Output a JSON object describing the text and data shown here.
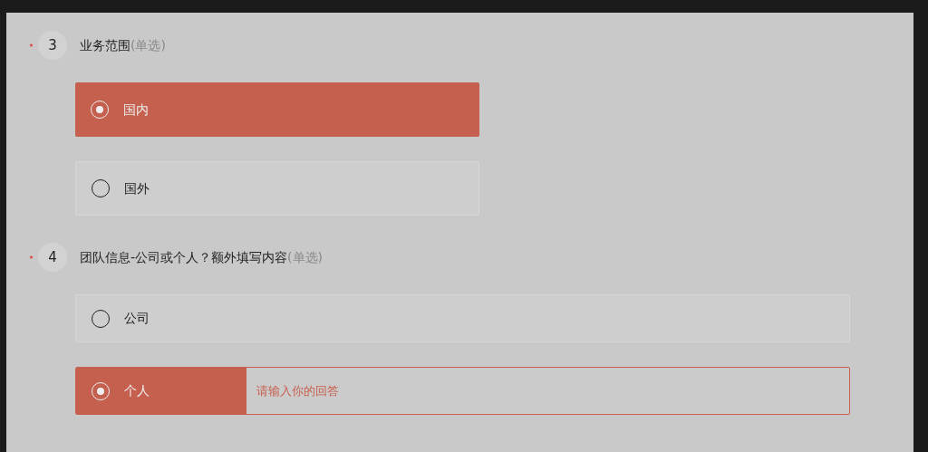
{
  "questions": [
    {
      "required": true,
      "number": "3",
      "title": "业务范围",
      "hint": "(单选)",
      "options": [
        {
          "label": "国内",
          "selected": true
        },
        {
          "label": "国外",
          "selected": false
        }
      ]
    },
    {
      "required": true,
      "number": "4",
      "title": "团队信息-公司或个人？额外填写内容",
      "hint": "(单选)",
      "options": [
        {
          "label": "公司",
          "selected": false
        },
        {
          "label": "个人",
          "selected": true,
          "placeholder": "请输入你的回答"
        }
      ]
    }
  ]
}
